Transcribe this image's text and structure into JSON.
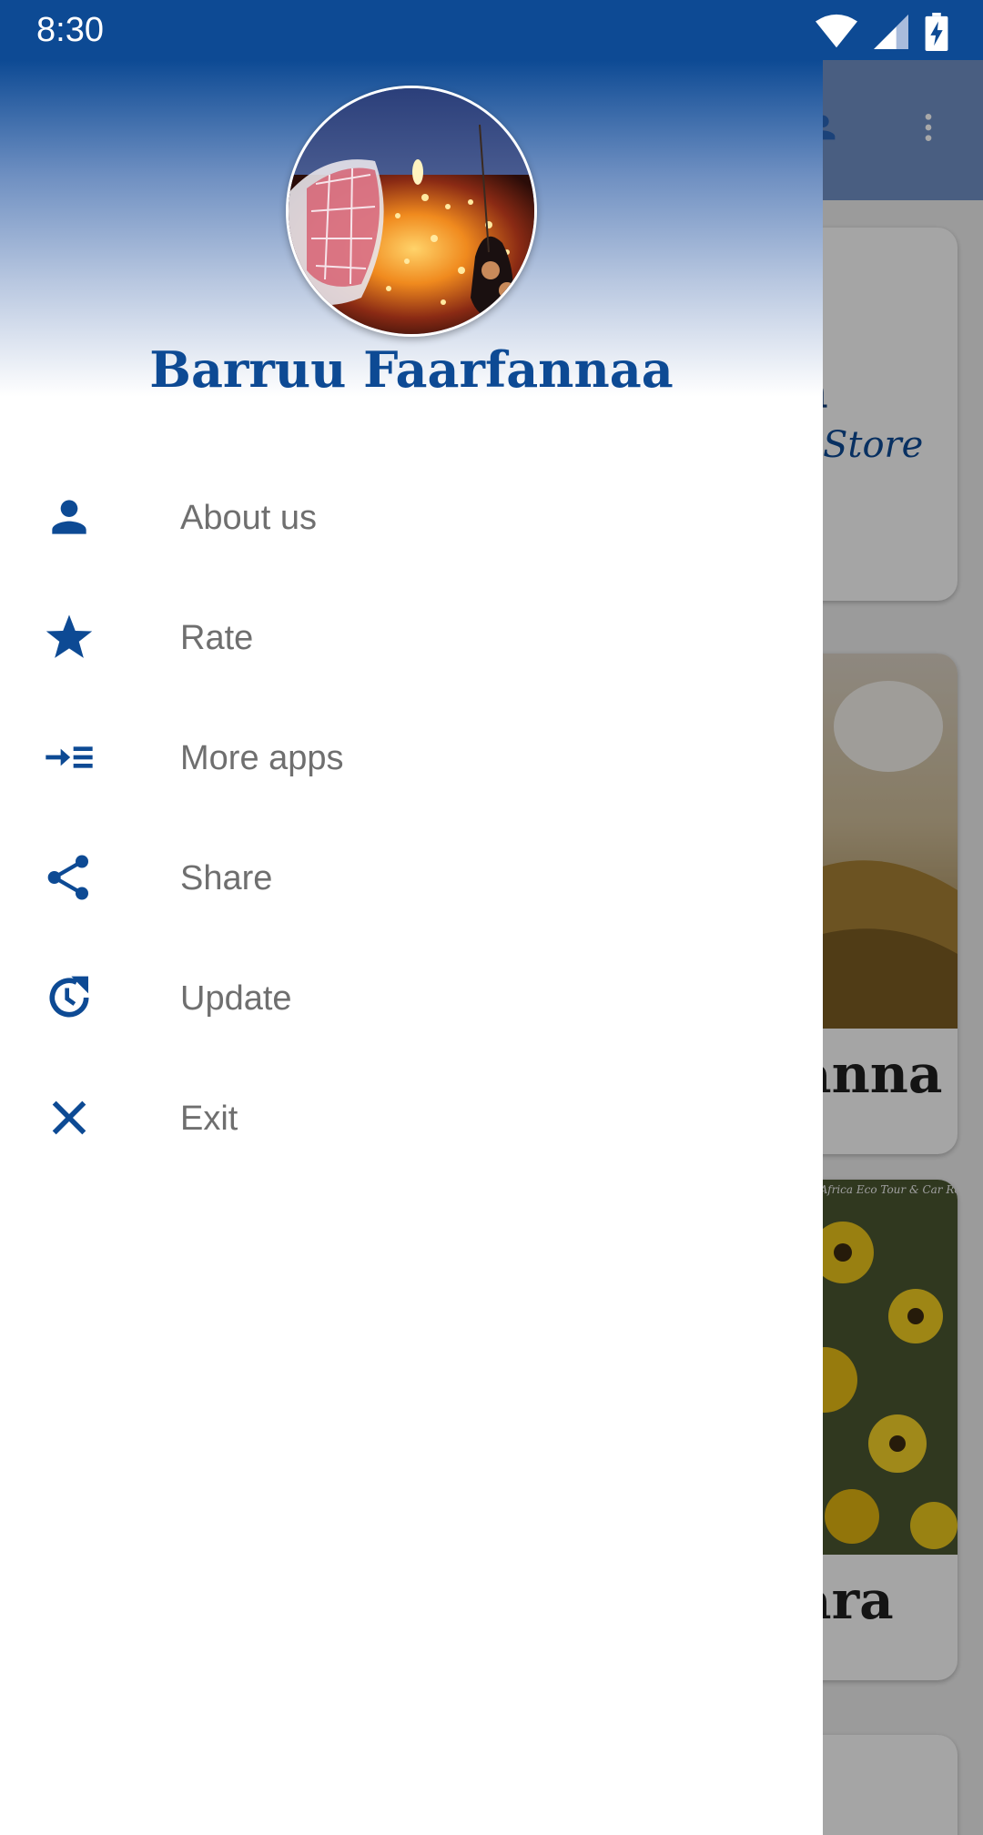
{
  "status_bar": {
    "time": "8:30",
    "icons": [
      "wifi-icon",
      "signal-icon",
      "battery-charging-icon"
    ]
  },
  "drawer": {
    "app_name": "Barruu Faarfannaa",
    "avatar": "app-logo-image",
    "menu": [
      {
        "label": "About us",
        "icon": "person-icon"
      },
      {
        "label": "Rate",
        "icon": "star-icon"
      },
      {
        "label": "More apps",
        "icon": "more-apps-icon"
      },
      {
        "label": "Share",
        "icon": "share-icon"
      },
      {
        "label": "Update",
        "icon": "update-icon"
      },
      {
        "label": "Exit",
        "icon": "close-icon"
      }
    ]
  },
  "background": {
    "card1_text": "a",
    "card1_sub": "Store",
    "card2_text": "anna",
    "card3_text": "ara",
    "card3_caption": "East Africa Eco Tour & Car Rental"
  },
  "colors": {
    "brand": "#0d4a94",
    "menu_text": "#6f6f6f",
    "drawer_bg": "#ffffff"
  }
}
